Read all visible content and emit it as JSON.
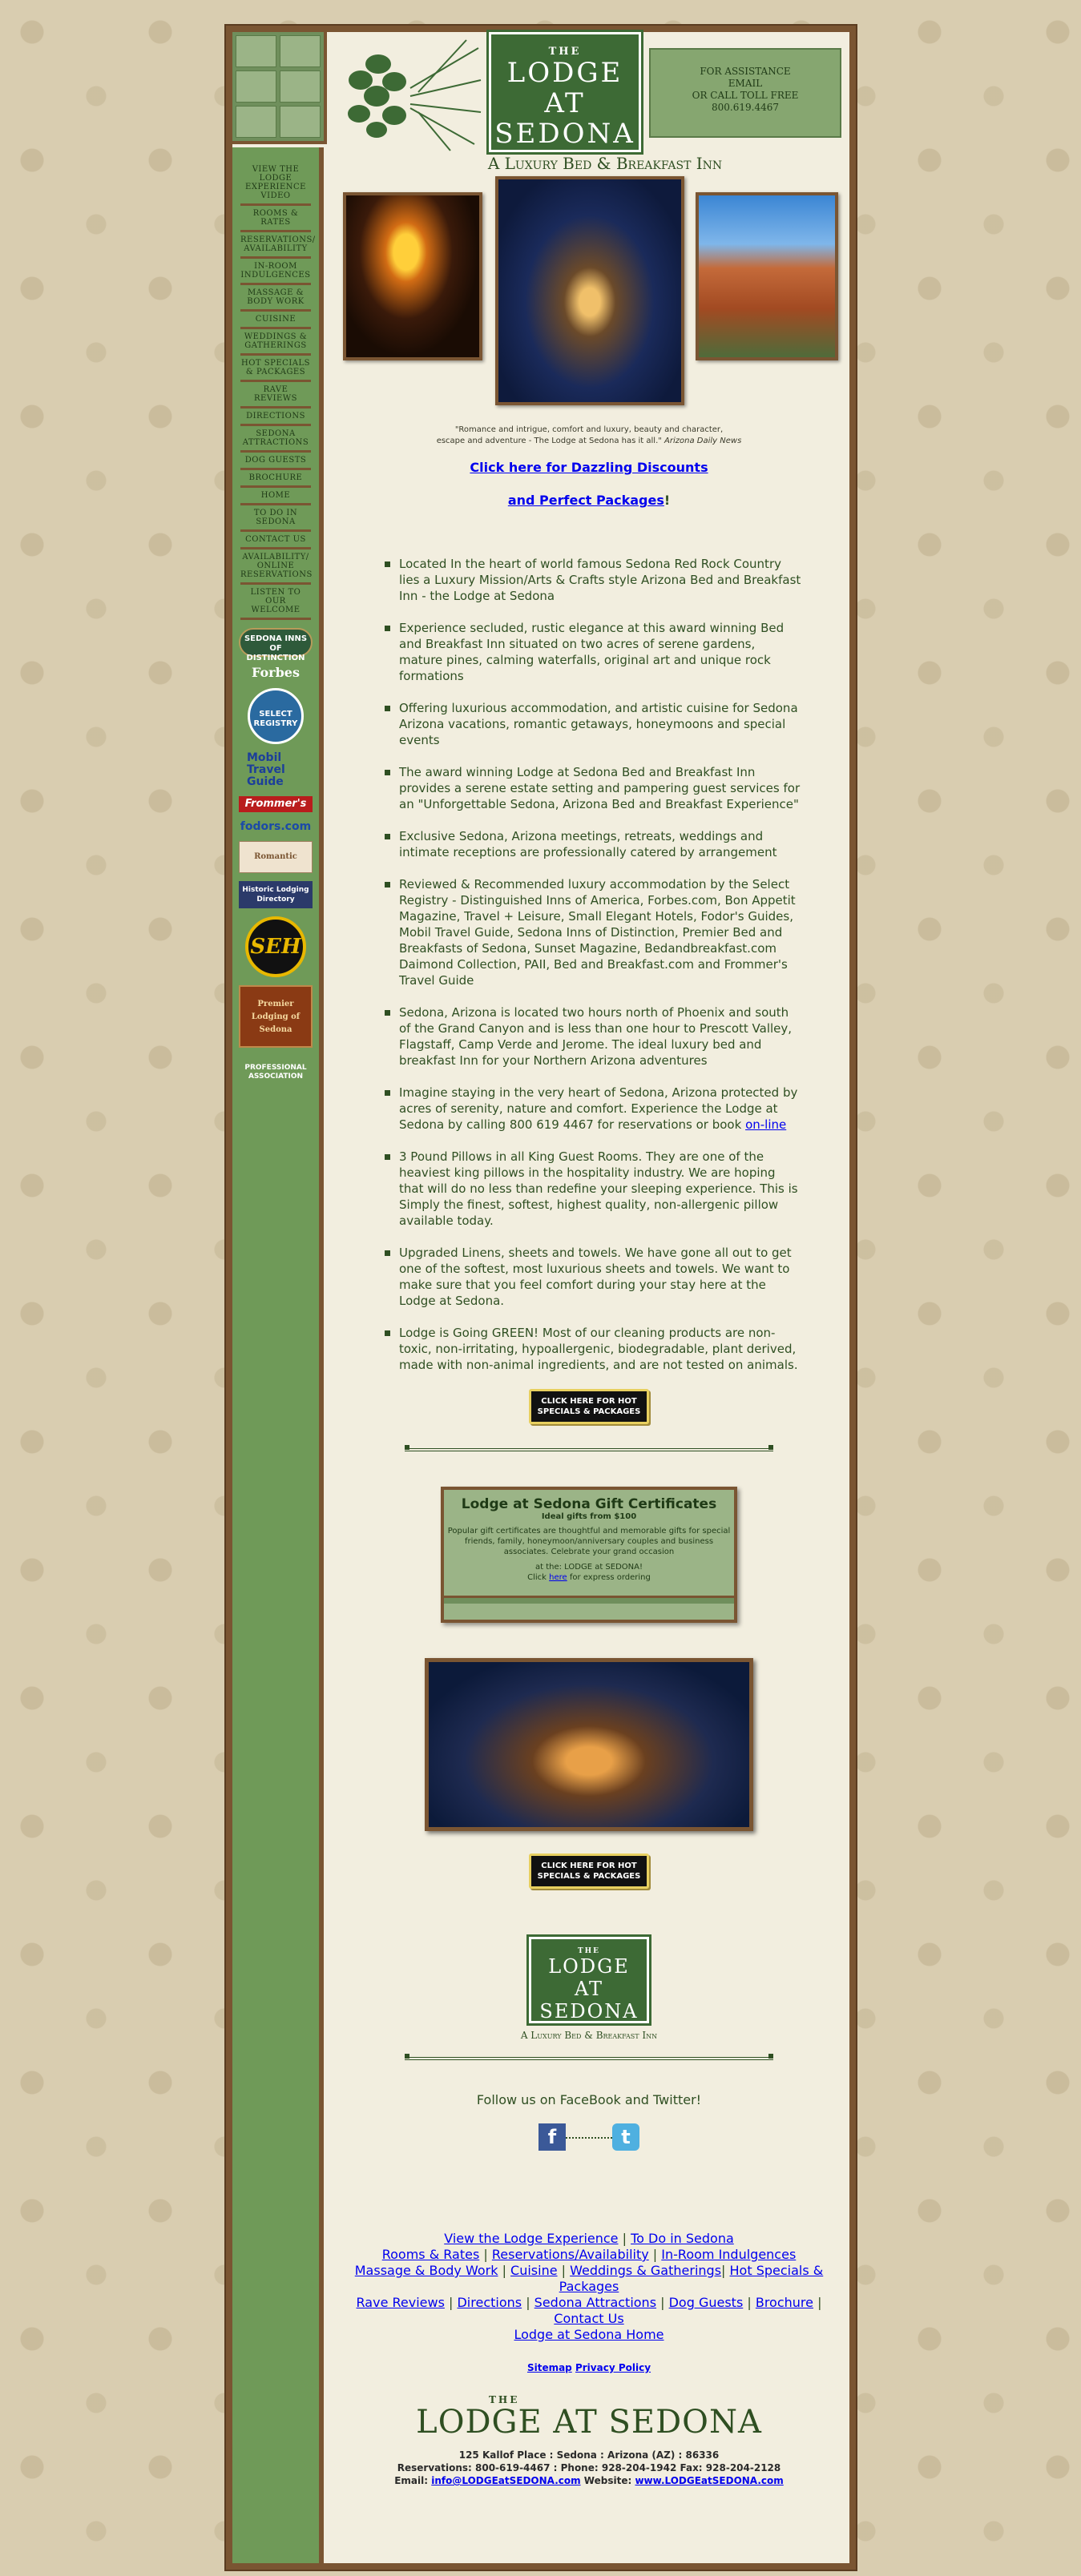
{
  "header": {
    "logo_small": "THE",
    "logo_line1": "LODGE AT",
    "logo_line2": "SEDONA",
    "assist_lines": [
      "FOR ASSISTANCE",
      "EMAIL",
      "OR CALL TOLL FREE",
      "800.619.4467"
    ],
    "tagline": "A Luxury Bed & Breakfast Inn"
  },
  "sidebar": {
    "items": [
      "View the Lodge Experience Video",
      "Rooms & Rates",
      "Reservations/ Availability",
      "In-Room Indulgences",
      "Massage & Body Work",
      "Cuisine",
      "Weddings & Gatherings",
      "Hot Specials & Packages",
      "Rave Reviews",
      "Directions",
      "Sedona Attractions",
      "Dog Guests",
      "Brochure",
      "Home",
      "To Do in Sedona",
      "Contact Us",
      "Availability/ Online Reservations",
      "Listen to our Welcome"
    ],
    "badges": {
      "sedona_inns": "SEDONA INNS OF DISTINCTION",
      "forbes": "Forbes",
      "select": "SELECT REGISTRY",
      "mobil": "Mobil Travel Guide",
      "frommers": "Frommer's",
      "fodors": "fodors.com",
      "paper": "Romantic",
      "historic": "Historic Lodging Directory",
      "seh": "SEH",
      "premier": "Premier Lodging of Sedona",
      "assoc": "PROFESSIONAL ASSOCIATION"
    }
  },
  "main": {
    "quote_line1": "\"Romance and intrigue, comfort and luxury, beauty and character,",
    "quote_line2": "escape and adventure - The Lodge at Sedona has it all.\"",
    "quote_source": "Arizona Daily News",
    "promo_link1": "Click here for Dazzling Discounts",
    "promo_link2": "and Perfect Packages",
    "promo_bang": "!",
    "bullets": [
      "Located In the heart of world famous Sedona Red Rock Country lies a Luxury Mission/Arts & Crafts style Arizona Bed and Breakfast Inn - the Lodge at Sedona",
      "Experience secluded, rustic elegance at this award winning Bed and Breakfast Inn situated on two acres of serene gardens, mature pines, calming waterfalls, original art and unique rock formations",
      "Offering luxurious accommodation, and artistic cuisine for Sedona Arizona vacations, romantic getaways, honeymoons and special events",
      "The award winning Lodge at Sedona Bed and Breakfast Inn provides a serene estate setting and pampering guest services for an \"Unforgettable Sedona, Arizona Bed and Breakfast Experience\"",
      "Exclusive Sedona, Arizona meetings, retreats, weddings and intimate receptions are professionally catered by arrangement",
      "Reviewed & Recommended luxury accommodation by the Select Registry - Distinguished Inns of America, Forbes.com, Bon Appetit Magazine, Travel + Leisure, Small Elegant Hotels, Fodor's Guides, Mobil Travel Guide, Sedona Inns of Distinction, Premier Bed and Breakfasts of Sedona, Sunset Magazine, Bedandbreakfast.com Daimond Collection, PAII, Bed and Breakfast.com and Frommer's Travel Guide",
      "Sedona, Arizona is located two hours north of Phoenix and south of the Grand Canyon and is less than one hour to Prescott Valley, Flagstaff, Camp Verde and Jerome. The ideal luxury bed and breakfast Inn for your Northern Arizona adventures",
      "Imagine staying in the very heart of Sedona, Arizona protected by acres of serenity, nature and comfort. Experience the Lodge at Sedona by calling 800 619 4467 for reservations or book",
      "3 Pound Pillows in all King Guest Rooms. They are one of the heaviest king pillows in the hospitality industry. We are hoping that will do no less than redefine your sleeping experience. This is Simply the finest, softest, highest quality, non-allergenic pillow available today.",
      "Upgraded Linens, sheets and towels. We have gone all out to get one of the softest, most luxurious sheets and towels. We want to make sure that you feel comfort during your stay here at the Lodge at Sedona.",
      "Lodge is Going GREEN! Most of our cleaning products are non-toxic, non-irritating, hypoallergenic, biodegradable, plant derived, made with non-animal ingredients, and are not tested on animals."
    ],
    "online_link": "on-line",
    "hot_button_line1": "CLICK HERE FOR HOT",
    "hot_button_line2": "SPECIALS & PACKAGES",
    "gift": {
      "title": "Lodge at Sedona Gift Certificates",
      "subtitle": "Ideal gifts from $100",
      "body": "Popular gift certificates are thoughtful and memorable gifts for special friends, family, honeymoon/anniversary couples and business associates. Celebrate your grand occasion",
      "at_the": "at the:  LODGE at SEDONA!",
      "click": "Click",
      "here": "here",
      "express": "for express ordering"
    },
    "logo2_small": "THE",
    "logo2_line1": "LODGE AT",
    "logo2_line2": "SEDONA",
    "logo2_tag": "A Luxury Bed & Breakfast Inn",
    "follow": "Follow us on FaceBook and Twitter!",
    "facebook_glyph": "f",
    "twitter_glyph": "t"
  },
  "footer": {
    "row1": [
      "View the Lodge Experience",
      "To Do in Sedona"
    ],
    "row2": [
      "Rooms & Rates",
      "Reservations/Availability",
      "In-Room Indulgences"
    ],
    "row3": [
      "Massage & Body Work",
      "Cuisine",
      "Weddings & Gatherings",
      "Hot Specials & Packages"
    ],
    "row4": [
      "Rave Reviews",
      "Directions",
      "Sedona Attractions",
      "Dog Guests",
      "Brochure"
    ],
    "contact": "Contact Us",
    "home": "Lodge at Sedona Home",
    "sitemap": "Sitemap",
    "privacy": "Privacy Policy",
    "logo_small": "THE",
    "logo_big": "LODGE AT SEDONA",
    "address": "125 Kallof Place : Sedona : Arizona (AZ) : 86336",
    "phones": "Reservations: 800-619-4467 :  Phone: 928-204-1942  Fax: 928-204-2128",
    "email_label": "Email:",
    "email": "info@LODGEatSEDONA.com",
    "website_label": "Website:",
    "website": "www.LODGEatSEDONA.com"
  }
}
